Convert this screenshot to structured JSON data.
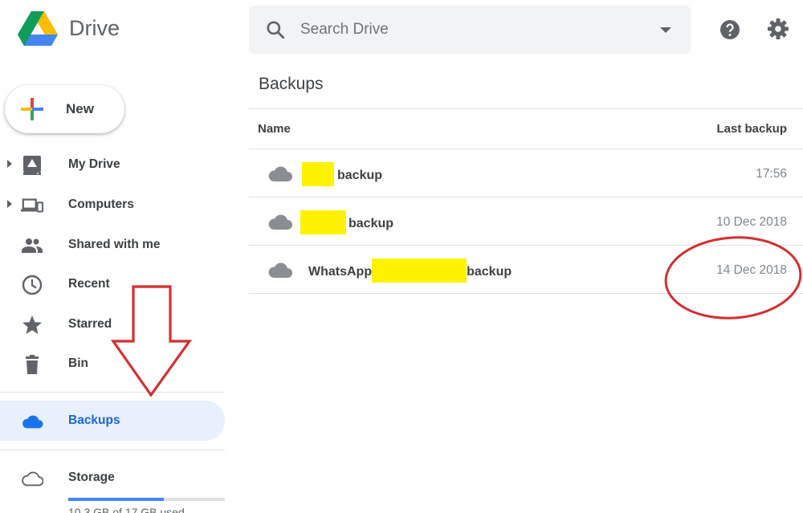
{
  "app": {
    "title": "Drive"
  },
  "search": {
    "placeholder": "Search Drive",
    "icon": "search-icon"
  },
  "header": {
    "help_icon": "help-icon",
    "settings_icon": "gear-icon"
  },
  "new_button": {
    "label": "New"
  },
  "sidebar": {
    "items": [
      {
        "label": "My Drive",
        "icon": "my-drive-icon",
        "expandable": true
      },
      {
        "label": "Computers",
        "icon": "computers-icon",
        "expandable": true
      },
      {
        "label": "Shared with me",
        "icon": "people-icon",
        "expandable": false
      },
      {
        "label": "Recent",
        "icon": "clock-icon",
        "expandable": false
      },
      {
        "label": "Starred",
        "icon": "star-icon",
        "expandable": false
      },
      {
        "label": "Bin",
        "icon": "trash-icon",
        "expandable": false
      },
      {
        "label": "Backups",
        "icon": "cloud-icon",
        "active": true
      },
      {
        "label": "Storage",
        "icon": "cloud-outline-icon"
      }
    ],
    "storage": {
      "text": "10.3 GB of 17 GB used",
      "fraction": 0.61
    }
  },
  "main": {
    "title": "Backups",
    "columns": {
      "name": "Name",
      "last_backup": "Last backup"
    },
    "rows": [
      {
        "prefix": "",
        "suffix": "backup",
        "last_backup": "17:56"
      },
      {
        "prefix": "",
        "suffix": "backup",
        "last_backup": "10 Dec 2018"
      },
      {
        "prefix": "WhatsApp",
        "suffix": "backup",
        "last_backup": "14 Dec 2018"
      }
    ]
  },
  "colors": {
    "accent": "#1967d2",
    "active_bg": "#e8f0fe",
    "redaction": "#fff200",
    "annotation": "#d32f2f"
  }
}
